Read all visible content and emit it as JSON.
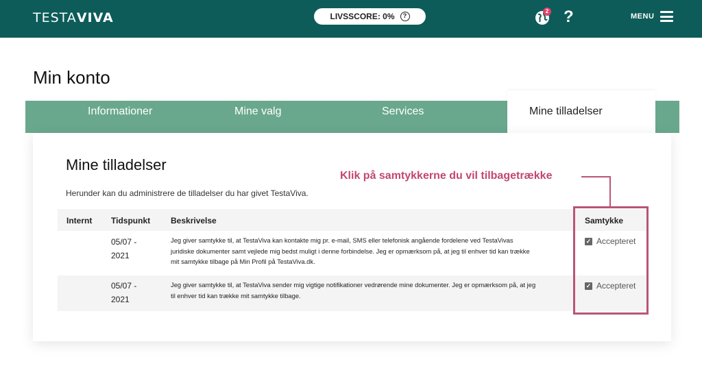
{
  "header": {
    "logo_light": "TESTA",
    "logo_bold": "VIVA",
    "score_label": "LIVSSCORE: 0%",
    "help_icon_glyph": "?",
    "notification_count": "2",
    "help_glyph": "?",
    "menu_label": "MENU",
    "bg_color": "#0d5c5a"
  },
  "page": {
    "title": "Min konto"
  },
  "tabs": [
    {
      "label": "Informationer"
    },
    {
      "label": "Mine valg"
    },
    {
      "label": "Services"
    },
    {
      "label": "Mine tilladelser",
      "active": true
    }
  ],
  "section": {
    "title": "Mine tilladelser",
    "intro": "Herunder kan du administrere de tilladelser du har givet TestaViva."
  },
  "annotation": {
    "callout": "Klik på samtykkerne du vil tilbagetrække",
    "color": "#c2466f"
  },
  "table": {
    "headers": [
      "Internt",
      "Tidspunkt",
      "Beskrivelse",
      "Samtykke"
    ],
    "rows": [
      {
        "internal": "",
        "date_line1": "05/07 -",
        "date_line2": "2021",
        "desc_line1": "Jeg giver samtykke til, at TestaViva kan kontakte mig pr. e-mail, SMS eller telefonisk angående fordelene ved TestaVivas",
        "desc_line2": "juridiske dokumenter samt vejlede mig bedst muligt i denne forbindelse. Jeg er opmærksom på, at jeg til enhver tid kan trække",
        "desc_line3": "mit samtykke tilbage på Min Profil på TestaViva.dk.",
        "consent": "Accepteret"
      },
      {
        "internal": "",
        "date_line1": "05/07 -",
        "date_line2": "2021",
        "desc_line1": "Jeg giver samtykke til, at TestaViva sender mig vigtige notifikationer vedrørende mine dokumenter. Jeg er opmærksom på, at jeg",
        "desc_line2": "til enhver tid kan trække mit samtykke tilbage.",
        "consent": "Accepteret"
      }
    ]
  },
  "colors": {
    "tabbar": "#6aa88e",
    "highlight": "#b85575"
  }
}
